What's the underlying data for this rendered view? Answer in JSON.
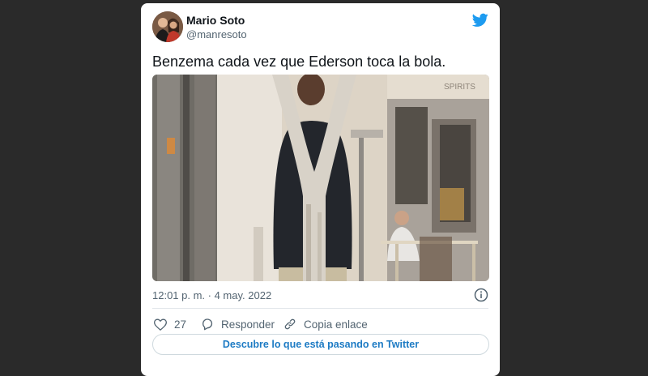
{
  "tweet": {
    "author_name": "Mario Soto",
    "author_handle": "@manresoto",
    "text": "Benzema cada vez que Ederson toca la bola.",
    "timestamp": "12:01 p. m. · 4 may. 2022",
    "brand_icon": "twitter-bird-icon",
    "brand_color": "#1d9bf0",
    "photo_sign_text": "SPIRITS"
  },
  "actions": {
    "like_count": "27",
    "reply_label": "Responder",
    "copy_link_label": "Copia enlace"
  },
  "cta": {
    "label": "Descubre lo que está pasando en Twitter",
    "color": "#1d7bc4"
  }
}
